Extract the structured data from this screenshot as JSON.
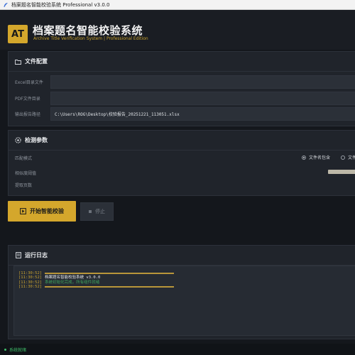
{
  "window": {
    "title": "档案题名智能校验系统 Professional v3.0.0"
  },
  "header": {
    "logo_text": "AT",
    "title": "档案题名智能校验系统",
    "subtitle": "Archive Title Verification System | Professional Edition"
  },
  "file_config": {
    "title": "文件配置",
    "icon": "folder-icon",
    "rows": [
      {
        "label": "Excel目录文件",
        "value": ""
      },
      {
        "label": "PDF文件目录",
        "value": ""
      },
      {
        "label": "输出报告路径",
        "value": "C:\\Users\\ROG\\Desktop\\校验报告_20251221_113051.xlsx"
      }
    ]
  },
  "params": {
    "title": "检测参数",
    "icon": "gear-icon",
    "match_mode_label": "匹配模式",
    "match_options": [
      {
        "label": "文件名包含",
        "selected": true
      },
      {
        "label": "文件",
        "selected": false
      }
    ],
    "similarity_label": "相似度阈值",
    "pages_label": "提取页数"
  },
  "actions": {
    "start_label": "开始智能校验",
    "stop_label": "停止"
  },
  "log": {
    "title": "运行日志",
    "icon": "log-icon",
    "lines": [
      {
        "time": "[11:30:52]",
        "text": "",
        "kind": "rule",
        "color": "#b8963a"
      },
      {
        "time": "[11:30:52]",
        "text": "档案题名智能校验系统 v3.0.0",
        "kind": "text",
        "color": "#e6e8eb"
      },
      {
        "time": "[11:30:52]",
        "text": "系统初始化完成，所有组件就绪",
        "kind": "text",
        "color": "#3fa65e"
      },
      {
        "time": "[11:30:52]",
        "text": "",
        "kind": "rule",
        "color": "#b8963a"
      }
    ]
  },
  "status": {
    "text": "系统就绪",
    "color": "#3fbf6a"
  },
  "colors": {
    "accent": "#d4a72c",
    "background": "#14171c",
    "panel": "#20242b"
  }
}
